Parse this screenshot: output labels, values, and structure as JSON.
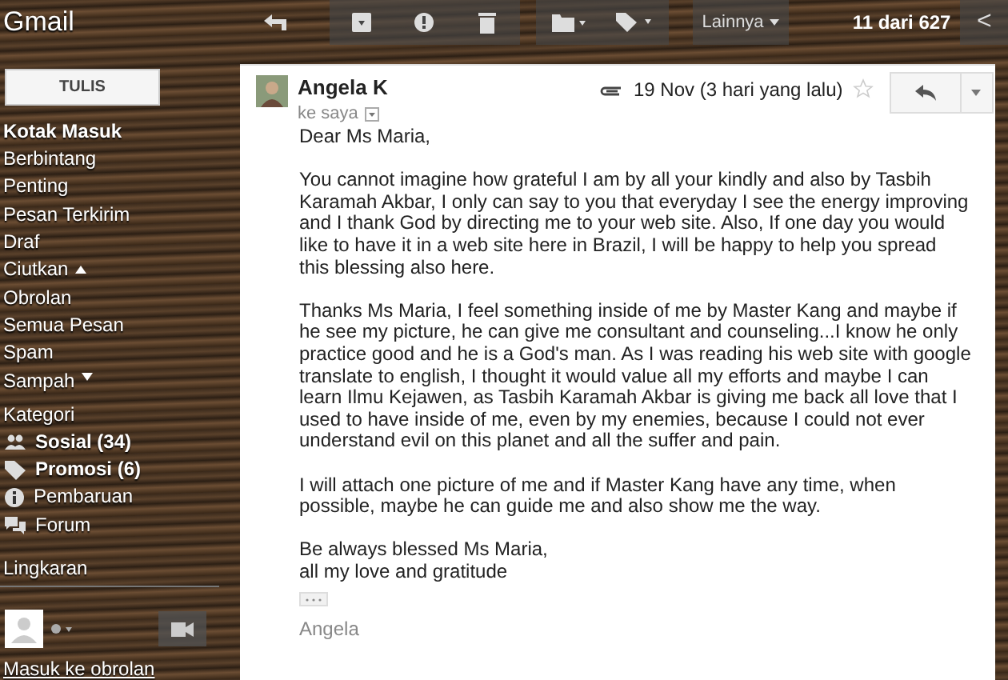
{
  "logo": "Gmail",
  "toolbar": {
    "buttons": [
      {
        "kind": "back"
      },
      {
        "kind": "archive"
      },
      {
        "kind": "spam"
      },
      {
        "kind": "delete"
      },
      {
        "kind": "move"
      },
      {
        "kind": "label"
      }
    ],
    "more": "Lainnya",
    "count": "11 dari 627",
    "prev": "<"
  },
  "sidebar": {
    "compose": "TULIS",
    "items": [
      {
        "label": "Kotak Masuk",
        "unread": true
      },
      {
        "label": "Berbintang",
        "unread": false
      },
      {
        "label": "Penting",
        "unread": false
      },
      {
        "label": "Pesan Terkirim",
        "unread": false
      },
      {
        "label": "Draf",
        "unread": false
      }
    ],
    "collapse": "Ciutkan",
    "more_items": [
      {
        "label": "Obrolan",
        "unread": false
      },
      {
        "label": "Semua Pesan",
        "unread": false
      },
      {
        "label": "Spam",
        "unread": false
      },
      {
        "label": "Sampah",
        "unread": false
      }
    ],
    "categories_heading": "Kategori",
    "categories": [
      {
        "kind": "social",
        "label": "Sosial (34)",
        "unread": true
      },
      {
        "kind": "promotions",
        "label": "Promosi (6)",
        "unread": true
      },
      {
        "kind": "updates",
        "label": "Pembaruan",
        "unread": false
      },
      {
        "kind": "forums",
        "label": "Forum",
        "unread": false
      }
    ],
    "circles": "Lingkaran",
    "chat_link": "Masuk ke obrolan"
  },
  "message": {
    "sender": "Angela K",
    "to": "ke saya",
    "date": "19 Nov (3 hari yang lalu)",
    "starred": false,
    "has_attachment": true,
    "greeting": "Dear Ms Maria,",
    "paragraphs": [
      "You cannot imagine how grateful I am by all your kindly and also by Tasbih Karamah Akbar, I only can say to you that everyday I see the energy improving and I thank God by directing me to your web site. Also, If one day you would like to have it in a web site here in Brazil, I will be happy to help you spread this blessing also here.",
      "Thanks Ms Maria, I feel something inside of me by Master Kang and maybe if he see my picture, he can give me consultant and counseling...I know he only practice good and he is a God's man. As I was reading his web site with google translate to english, I thought it would value all my efforts and maybe I can learn Ilmu Kejawen, as Tasbih Karamah Akbar is giving me back all love that I used to have inside of me, even by my enemies, because I could not ever understand evil on this planet and all the suffer and pain.",
      "I will attach one picture of me and if Master Kang have any time, when possible, maybe he can guide me and also show me the way."
    ],
    "closing": [
      "Be always blessed Ms Maria,",
      "all my love and gratitude"
    ],
    "signature": "Angela"
  }
}
